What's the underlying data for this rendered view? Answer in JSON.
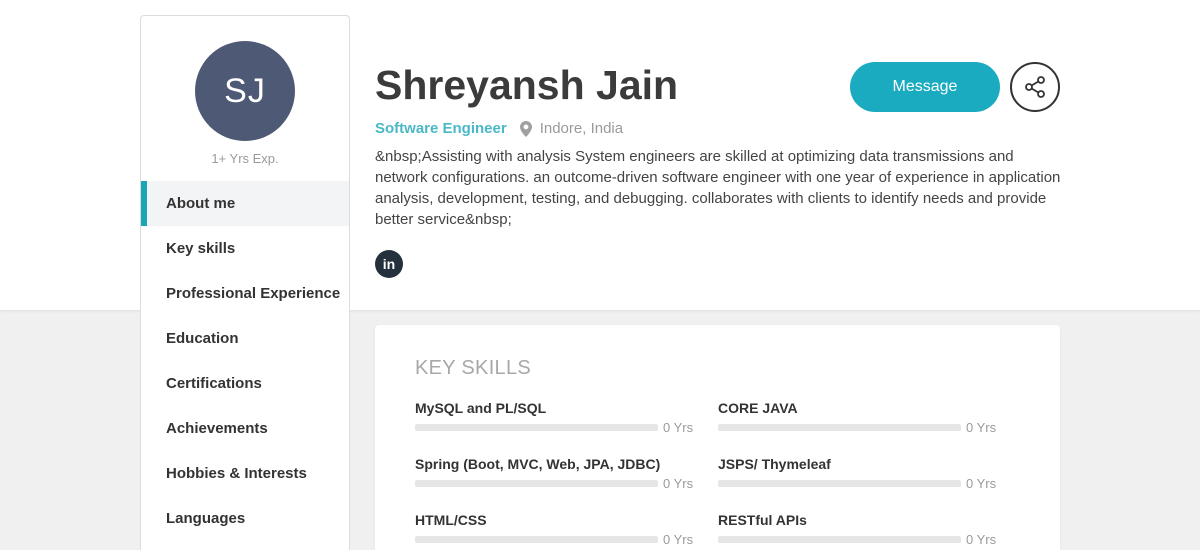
{
  "profile": {
    "initials": "SJ",
    "experience": "1+ Yrs Exp.",
    "name": "Shreyansh Jain",
    "role": "Software Engineer",
    "location": "Indore, India",
    "bio": "&nbsp;Assisting with analysis System engineers are skilled at optimizing data transmissions and network configurations. an outcome-driven software engineer with one year of experience in application analysis, development, testing, and debugging. collaborates with clients to identify needs and provide better service&nbsp;",
    "linkedin_label": "in"
  },
  "actions": {
    "message_label": "Message",
    "share_icon": "share-icon"
  },
  "sidebar": {
    "items": [
      {
        "label": "About me",
        "active": true
      },
      {
        "label": "Key skills",
        "active": false
      },
      {
        "label": "Professional Experience",
        "active": false
      },
      {
        "label": "Education",
        "active": false
      },
      {
        "label": "Certifications",
        "active": false
      },
      {
        "label": "Achievements",
        "active": false
      },
      {
        "label": "Hobbies & Interests",
        "active": false
      },
      {
        "label": "Languages",
        "active": false
      }
    ]
  },
  "skills": {
    "title": "KEY SKILLS",
    "items": [
      {
        "name": "MySQL and PL/SQL",
        "years": "0 Yrs",
        "level": 0
      },
      {
        "name": "CORE JAVA",
        "years": "0 Yrs",
        "level": 0
      },
      {
        "name": "Spring (Boot, MVC, Web, JPA, JDBC)",
        "years": "0 Yrs",
        "level": 0
      },
      {
        "name": "JSPS/ Thymeleaf",
        "years": "0 Yrs",
        "level": 0
      },
      {
        "name": "HTML/CSS",
        "years": "0 Yrs",
        "level": 0
      },
      {
        "name": "RESTful APIs",
        "years": "0 Yrs",
        "level": 0
      }
    ]
  },
  "colors": {
    "accent": "#1aabc0",
    "avatar_bg": "#4e5a75",
    "role_text": "#4bb8c6"
  }
}
